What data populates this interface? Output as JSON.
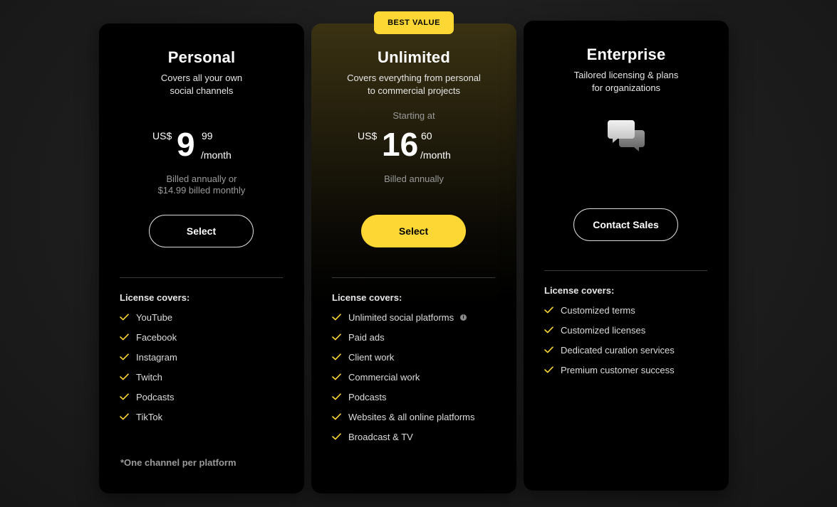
{
  "plans": {
    "personal": {
      "title": "Personal",
      "subtitle_line1": "Covers all your own",
      "subtitle_line2": "social channels",
      "currency": "US$",
      "price_whole": "9",
      "price_cents": "99",
      "period": "/month",
      "billing_line1": "Billed annually or",
      "billing_line2": "$14.99 billed monthly",
      "button_label": "Select",
      "covers_label": "License covers:",
      "features": [
        "YouTube",
        "Facebook",
        "Instagram",
        "Twitch",
        "Podcasts",
        "TikTok"
      ],
      "footnote": "*One channel per platform"
    },
    "unlimited": {
      "badge": "BEST VALUE",
      "title": "Unlimited",
      "subtitle_line1": "Covers everything from personal",
      "subtitle_line2": "to commercial projects",
      "starting_at": "Starting at",
      "currency": "US$",
      "price_whole": "16",
      "price_cents": "60",
      "period": "/month",
      "billing_line1": "Billed annually",
      "button_label": "Select",
      "covers_label": "License covers:",
      "features": [
        "Unlimited social platforms",
        "Paid ads",
        "Client work",
        "Commercial work",
        "Podcasts",
        "Websites & all online platforms",
        "Broadcast & TV"
      ],
      "info_icon": "info-icon"
    },
    "enterprise": {
      "title": "Enterprise",
      "subtitle_line1": "Tailored licensing & plans",
      "subtitle_line2": "for organizations",
      "icon": "chat-bubbles-icon",
      "button_label": "Contact Sales",
      "covers_label": "License covers:",
      "features": [
        "Customized terms",
        "Customized licenses",
        "Dedicated curation services",
        "Premium customer success"
      ]
    }
  },
  "colors": {
    "accent": "#fdd835",
    "background": "#1c1c1c",
    "card": "#000000",
    "muted_text": "#9a9a9a"
  }
}
